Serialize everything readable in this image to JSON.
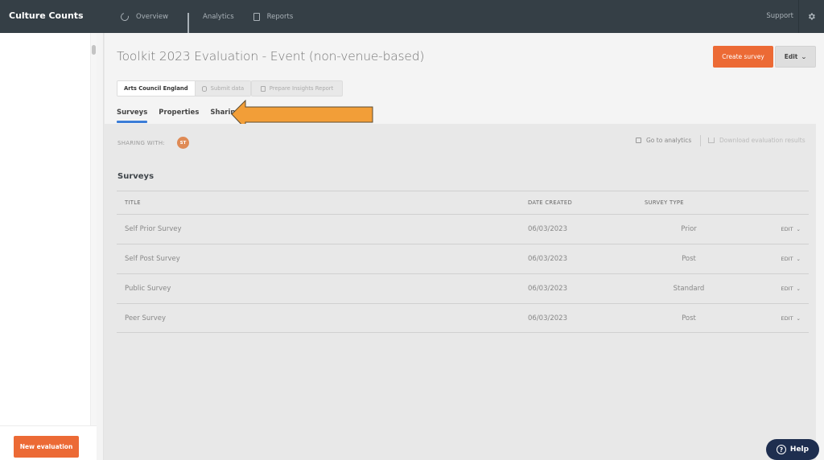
{
  "topbar": {
    "brand": "Culture Counts",
    "nav": [
      {
        "label": "Overview",
        "icon": "overview-icon"
      },
      {
        "label": "Analytics",
        "icon": "analytics-icon"
      },
      {
        "label": "Reports",
        "icon": "reports-icon"
      }
    ],
    "support_label": "Support",
    "settings_icon": "gear-icon"
  },
  "sidebar": {
    "new_evaluation_label": "New evaluation"
  },
  "header": {
    "title": "Toolkit 2023 Evaluation - Event (non-venue-based)",
    "create_survey_label": "Create survey",
    "edit_label": "Edit",
    "pills": {
      "organisation": "Arts Council England",
      "submit_data": "Submit data",
      "prepare_insights": "Prepare Insights Report"
    },
    "tabs": [
      {
        "label": "Surveys",
        "active": true
      },
      {
        "label": "Properties",
        "active": false
      },
      {
        "label": "Sharing",
        "active": false
      }
    ]
  },
  "annotation": {
    "arrow_color": "#f29e38",
    "points_to": "Sharing"
  },
  "sharing": {
    "label": "SHARING WITH:",
    "avatar_initials": "ST",
    "avatar_color": "#df8a55"
  },
  "actions": {
    "go_to_analytics": "Go to analytics",
    "download_results": "Download evaluation results"
  },
  "surveys": {
    "section_title": "Surveys",
    "columns": [
      "TITLE",
      "DATE CREATED",
      "SURVEY TYPE",
      ""
    ],
    "edit_label": "EDIT",
    "rows": [
      {
        "title": "Self Prior Survey",
        "date": "06/03/2023",
        "type": "Prior"
      },
      {
        "title": "Self Post Survey",
        "date": "06/03/2023",
        "type": "Post"
      },
      {
        "title": "Public Survey",
        "date": "06/03/2023",
        "type": "Standard"
      },
      {
        "title": "Peer Survey",
        "date": "06/03/2023",
        "type": "Post"
      }
    ]
  },
  "help": {
    "label": "Help"
  },
  "colors": {
    "topbar": "#353f46",
    "primary_orange": "#ec6a35",
    "tab_underline": "#3b7dd8",
    "help_button": "#1e2e4f"
  }
}
